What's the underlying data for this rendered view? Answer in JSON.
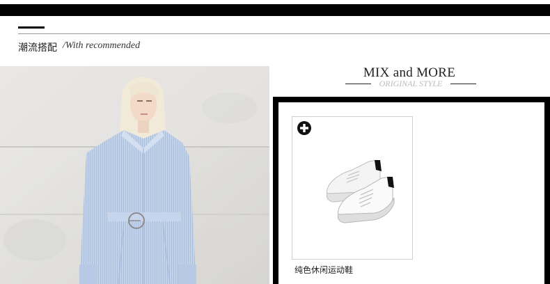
{
  "section": {
    "title": "潮流搭配",
    "subtitle": "/With recommended"
  },
  "mix": {
    "title": "MIX and MORE",
    "subtitle": "ORIGINAL STYLE"
  },
  "products": [
    {
      "name": "纯色休闲运动鞋",
      "icon": "add-circle-icon"
    }
  ],
  "colors": {
    "bar": "#000000",
    "frame": "#000000",
    "subtitle_gray": "#bdbdbd",
    "shirt_blue": "#b9cbe3"
  }
}
